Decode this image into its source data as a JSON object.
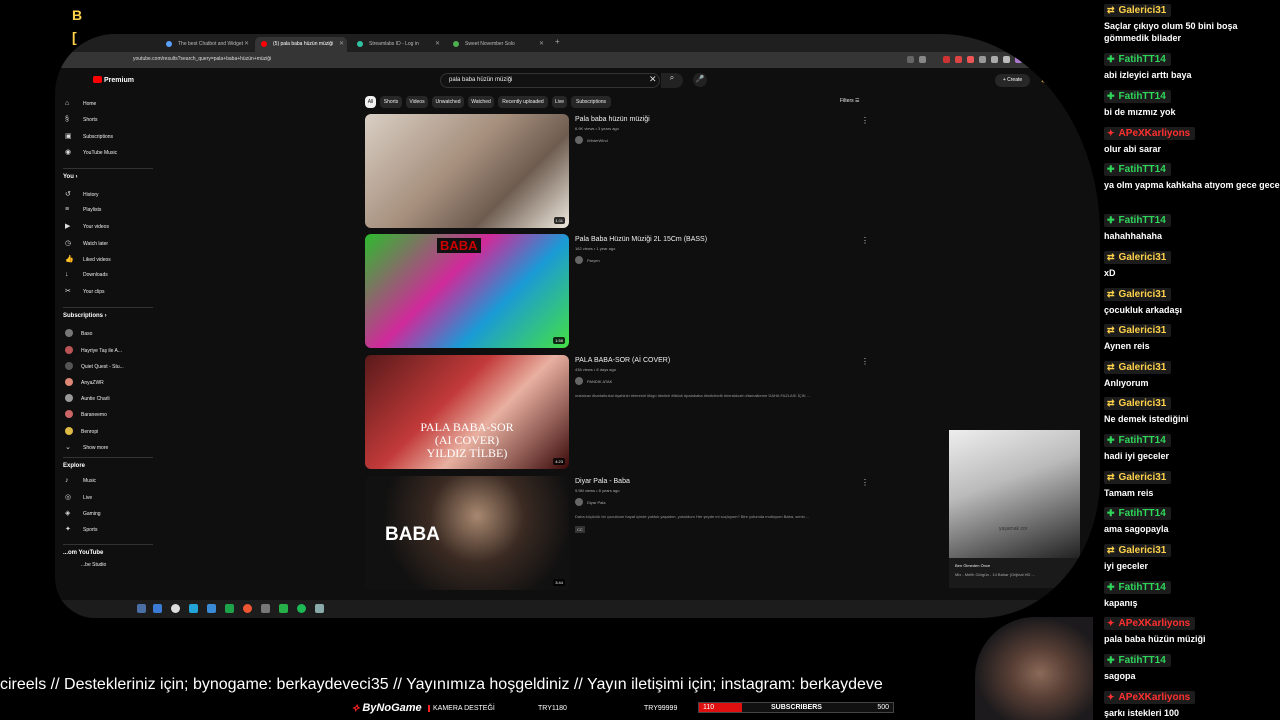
{
  "corner_text": [
    "B",
    "["
  ],
  "browser": {
    "tabs": [
      {
        "title": "The best Chatbot and Widget",
        "color": "#5aa0ff"
      },
      {
        "title": "(5) pala baba hüzün müziği",
        "color": "#ff0000",
        "active": true
      },
      {
        "title": "Streamlabs ID - Log in",
        "color": "#31c3a2"
      },
      {
        "title": "Sweet November Solo",
        "color": "#4caf50"
      }
    ],
    "url": "youtube.com/results?search_query=pala+baba+hüzün+müziği"
  },
  "youtube": {
    "logo": "Premium",
    "search_value": "pala baba hüzün müziği",
    "create_label": "Create",
    "sidebar": {
      "main": [
        {
          "icon": "home-icon",
          "glyph": "⌂",
          "label": "Home"
        },
        {
          "icon": "shorts-icon",
          "glyph": "§",
          "label": "Shorts"
        },
        {
          "icon": "subscriptions-icon",
          "glyph": "▣",
          "label": "Subscriptions"
        },
        {
          "icon": "youtube-music-icon",
          "glyph": "◉",
          "label": "YouTube Music"
        }
      ],
      "you_heading": "You",
      "you": [
        {
          "icon": "history-icon",
          "glyph": "↺",
          "label": "History"
        },
        {
          "icon": "playlists-icon",
          "glyph": "≡",
          "label": "Playlists"
        },
        {
          "icon": "your-videos-icon",
          "glyph": "▶",
          "label": "Your videos"
        },
        {
          "icon": "watch-later-icon",
          "glyph": "◷",
          "label": "Watch later"
        },
        {
          "icon": "liked-videos-icon",
          "glyph": "👍",
          "label": "Liked videos"
        },
        {
          "icon": "downloads-icon",
          "glyph": "↓",
          "label": "Downloads"
        },
        {
          "icon": "your-clips-icon",
          "glyph": "✂",
          "label": "Your clips"
        }
      ],
      "subs_heading": "Subscriptions",
      "subs": [
        {
          "label": "Baso",
          "color": "#777"
        },
        {
          "label": "Hayriye Taş ile A...",
          "color": "#b55"
        },
        {
          "label": "Quiet Quest - Stu...",
          "color": "#555"
        },
        {
          "label": "AnyaZWR",
          "color": "#d87"
        },
        {
          "label": "Auntie Charli",
          "color": "#999"
        },
        {
          "label": "Baraneemo",
          "color": "#c66"
        },
        {
          "label": "Benropi",
          "color": "#db4"
        }
      ],
      "show_more": "Show more",
      "explore_heading": "Explore",
      "explore": [
        {
          "icon": "music-icon",
          "glyph": "♪",
          "label": "Music"
        },
        {
          "icon": "live-icon",
          "glyph": "◎",
          "label": "Live"
        },
        {
          "icon": "gaming-icon",
          "glyph": "◈",
          "label": "Gaming"
        },
        {
          "icon": "sports-icon",
          "glyph": "✦",
          "label": "Sports"
        }
      ],
      "more_heading": "...om YouTube",
      "more": [
        {
          "label": "...be Studio"
        }
      ]
    },
    "chips": [
      "All",
      "Shorts",
      "Videos",
      "Unwatched",
      "Watched",
      "Recently uploaded",
      "Live",
      "Subscriptions"
    ],
    "filters_label": "Filters",
    "results": [
      {
        "title": "Pala baba hüzün müziği",
        "meta": "6.9K views • 3 years ago",
        "channel": "WinterWind",
        "duration": "1:11",
        "desc": ""
      },
      {
        "title": "Pala Baba Hüzün Müziği 2L 15Cm (BASS)",
        "meta": "162 views • 1 year ago",
        "channel": "Paryen",
        "duration": "1:58",
        "desc": ""
      },
      {
        "title": "PALA BABA-SOR (Aİ COVER)",
        "meta": "436 views • 8 days ago",
        "channel": "PANDIK ATAK",
        "duration": "4:23",
        "desc": "malatcaz #kartalbukal #şahinin #eteesiri #kigo #twitch #tiktok #palababa #twitchedit #neraldozin #tamalkeme DAHA FAZLASI İÇİN ..."
      },
      {
        "title": "Diyar Pala - Baba",
        "meta": "9.5M views • 8 years ago",
        "channel": "Diyar Pala",
        "duration": "3:44",
        "desc": "Daha küçücük bir çocuktum hayat içinde yoktuk yaşadım, yokuldum Her şeyde mi suçluyum? Bire yolumda mutluyum Baba, senin ...",
        "cc": "CC"
      }
    ],
    "thumb_texts": [
      "",
      "BABA",
      "PALA BABA-SOR\n(AI COVER)\nYILDIZ TİLBE)",
      "BABA"
    ],
    "miniplayer": {
      "video_text": "yaşamak zor",
      "title": "Ben Ölmeden Önce",
      "subtitle": "Mix - Melih Görgün - 14 Bahar (Orijinal HD ..."
    }
  },
  "chat": [
    {
      "name": "Galerici31",
      "type": "g",
      "text": "Saçlar çıkıyo olum 50 bini boşa gömmedik bilader"
    },
    {
      "name": "FatihTT14",
      "type": "f",
      "text": "abi izleyici arttı baya"
    },
    {
      "name": "FatihTT14",
      "type": "f",
      "text": "bi de mızmız yok"
    },
    {
      "name": "APeXKarliyons",
      "type": "a",
      "text": "olur abi sarar"
    },
    {
      "name": "FatihTT14",
      "type": "f",
      "text": "ya olm yapma kahkaha atıyom gece gece"
    },
    {
      "name": "FatihTT14",
      "type": "f",
      "text": "hahahhahaha"
    },
    {
      "name": "Galerici31",
      "type": "g",
      "text": "xD"
    },
    {
      "name": "Galerici31",
      "type": "g",
      "text": "çocukluk arkadaşı"
    },
    {
      "name": "Galerici31",
      "type": "g",
      "text": "Aynen reis"
    },
    {
      "name": "Galerici31",
      "type": "g",
      "text": "Anlıyorum"
    },
    {
      "name": "Galerici31",
      "type": "g",
      "text": "Ne demek istediğini"
    },
    {
      "name": "FatihTT14",
      "type": "f",
      "text": "hadi iyi geceler"
    },
    {
      "name": "Galerici31",
      "type": "g",
      "text": "Tamam reis"
    },
    {
      "name": "FatihTT14",
      "type": "f",
      "text": "ama sagopayla"
    },
    {
      "name": "Galerici31",
      "type": "g",
      "text": "iyi geceler"
    },
    {
      "name": "FatihTT14",
      "type": "f",
      "text": "kapanış"
    },
    {
      "name": "APeXKarliyons",
      "type": "a",
      "text": "pala baba hüzün müziği"
    },
    {
      "name": "FatihTT14",
      "type": "f",
      "text": "sagopa"
    },
    {
      "name": "APeXKarliyons",
      "type": "a",
      "text": "şarkı istekleri 100"
    }
  ],
  "chat_colors": {
    "g": "#ffd24a",
    "f": "#2ed65a",
    "a": "#ff3030"
  },
  "overlay": {
    "ticker": "cireels // Destekleriniz için; bynogame: berkaydeveci35 // Yayınımıza hoşgeldiniz // Yayın iletişimi için; instagram: berkaydeve",
    "brand": "ByNoGame",
    "camera_support": "KAMERA DESTEĞİ",
    "try1": "TRY1180",
    "try2": "TRY99999",
    "sub_current": "110",
    "sub_label": "SUBSCRIBERS",
    "sub_goal": "500",
    "sub_progress": 0.22
  }
}
